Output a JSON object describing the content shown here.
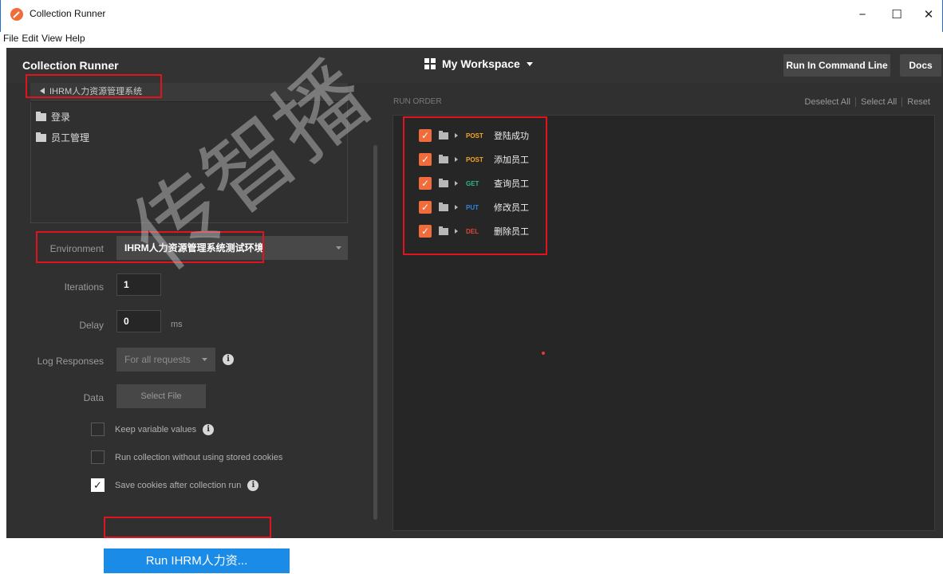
{
  "window": {
    "title": "Collection Runner",
    "minimize": "−",
    "maximize": "☐",
    "close": "✕"
  },
  "menu": [
    "File",
    "Edit",
    "View",
    "Help"
  ],
  "header": {
    "title": "Collection Runner",
    "workspace": "My Workspace",
    "run_cli": "Run In Command Line",
    "docs": "Docs"
  },
  "collection": {
    "breadcrumb": "IHRM人力资源管理系统",
    "folders": [
      {
        "label": "登录"
      },
      {
        "label": "员工管理"
      }
    ]
  },
  "settings": {
    "environment_label": "Environment",
    "environment_value": "IHRM人力资源管理系统测试环境",
    "iterations_label": "Iterations",
    "iterations_value": "1",
    "delay_label": "Delay",
    "delay_value": "0",
    "delay_unit": "ms",
    "log_label": "Log Responses",
    "log_value": "For all requests",
    "data_label": "Data",
    "select_file": "Select File",
    "keep_vars": "Keep variable values",
    "no_cookies": "Run collection without using stored cookies",
    "save_cookies": "Save cookies after collection run",
    "info_glyph": "i"
  },
  "run_button": "Run IHRM人力资...",
  "run_order": {
    "label": "RUN ORDER",
    "deselect_all": "Deselect All",
    "select_all": "Select All",
    "reset": "Reset",
    "requests": [
      {
        "method": "POST",
        "color": "#f4a623",
        "name": "登陆成功"
      },
      {
        "method": "POST",
        "color": "#f4a623",
        "name": "添加员工"
      },
      {
        "method": "GET",
        "color": "#2cba80",
        "name": "查询员工"
      },
      {
        "method": "PUT",
        "color": "#2d86e6",
        "name": "修改员工"
      },
      {
        "method": "DEL",
        "color": "#e5423a",
        "name": "删除员工"
      }
    ]
  },
  "watermark": "传智播"
}
